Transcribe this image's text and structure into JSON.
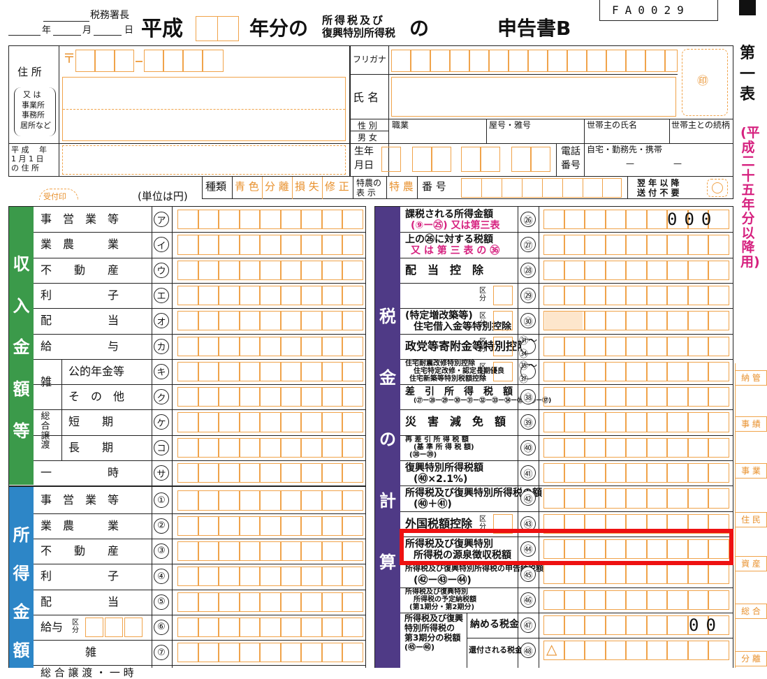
{
  "header": {
    "office_suffix": "税務署長",
    "date_year": "年",
    "date_month": "月",
    "date_day": "日",
    "era": "平成",
    "year_suffix": "年分の",
    "tax_line1": "所得税及び",
    "tax_line2": "復興特別所得税",
    "no": "の",
    "title": "申告書B",
    "form_code": "FA0029"
  },
  "address": {
    "label": "住 所",
    "sub_line1": "又 は",
    "sub_line2": "事業所",
    "sub_line3": "事務所",
    "sub_line4": "居所など",
    "postal_mark": "〒",
    "jan1_line1": "平 成　 年",
    "jan1_line2": "1 月 1 日",
    "jan1_line3": "の 住 所"
  },
  "person": {
    "furigana": "フリガナ",
    "name": "氏 名",
    "seal": "㊞",
    "gender": "性 別",
    "male_female": "男 女",
    "occupation": "職業",
    "trade_name": "屋号・雅号",
    "householder": "世帯主の氏名",
    "relation": "世帯主との続柄",
    "birth_line1": "生年",
    "birth_line2": "月日",
    "phone_line1": "電話",
    "phone_line2": "番号",
    "phone_type": "自宅・勤務先・携帯",
    "phone_dash": "—"
  },
  "type_row": {
    "reception": "受付印",
    "unit": "(単位は円)",
    "kind": "種類",
    "options": [
      "青 色",
      "分 離",
      "損 失",
      "修 正"
    ],
    "tokuno_label_1": "特農の",
    "tokuno_label_2": "表 示",
    "tokuno": "特 農",
    "number": "番 号",
    "next_year_1": "翌 年 以 降",
    "next_year_2": "送 付 不 要"
  },
  "side_title": "第一表",
  "side_sub": "(平成二十五年分以降用)",
  "income_section": {
    "title": [
      "収",
      "入",
      "金",
      "額",
      "等"
    ],
    "rows": [
      {
        "label": "事　営　業　等",
        "mark": "ア"
      },
      {
        "label": "業　農　　　業",
        "mark": "イ"
      },
      {
        "label": "不　　動　　産",
        "mark": "ウ"
      },
      {
        "label": "利　　　　　子",
        "mark": "エ"
      },
      {
        "label": "配　　　　　当",
        "mark": "オ"
      },
      {
        "label": "給　　　　　与",
        "mark": "カ"
      },
      {
        "label": "公的年金等",
        "mark": "キ"
      },
      {
        "label": "そ　の　他",
        "mark": "ク"
      },
      {
        "label": "短　　期",
        "mark": "ケ"
      },
      {
        "label": "長　　期",
        "mark": "コ"
      },
      {
        "label": "一　　　　　時",
        "mark": "サ"
      }
    ],
    "misc": "雑",
    "transfer": [
      "総",
      "合",
      "譲",
      "渡"
    ]
  },
  "shotoku_section": {
    "title": [
      "所",
      "得",
      "金",
      "額"
    ],
    "rows": [
      {
        "label": "事　営　業　等",
        "mark": "①"
      },
      {
        "label": "業　農　　　業",
        "mark": "②"
      },
      {
        "label": "不　　動　　産",
        "mark": "③"
      },
      {
        "label": "利　　　　　子",
        "mark": "④"
      },
      {
        "label": "配　　　　　当",
        "mark": "⑤"
      },
      {
        "label": "給与",
        "mark": "⑥"
      },
      {
        "label": "雑",
        "mark": "⑦"
      }
    ],
    "kubun": "区分",
    "bottom_partial": "総 合 譲 渡 ・ 一 時"
  },
  "tax_section": {
    "title": [
      "税",
      "金",
      "の",
      "計",
      "算"
    ],
    "rows": [
      {
        "label_1": "課税される所得金額",
        "label_2": "(⑨ー㉕) 又は第三表",
        "mark": "㉖",
        "value": "000"
      },
      {
        "label_1": "上の㉖に対する税額",
        "label_2": "又 は 第 三 表 の ㊱",
        "mark": "㉗"
      },
      {
        "label_1": "配　当　控　除",
        "mark": "㉘"
      },
      {
        "label_1": "",
        "mark": "㉙"
      },
      {
        "label_1": "(特定増改築等)",
        "label_2": "住宅借入金等特別控除",
        "mark": "㉚"
      },
      {
        "label_1": "政党等寄附金等特別控除",
        "mark": "㉛〜㉞"
      },
      {
        "label_1": "住宅耐震改修特別控除",
        "label_2": "住宅特定改修・認定長期優良",
        "label_3": "住宅新築等特別税額控除",
        "mark": "㉟〜㊲"
      },
      {
        "label_1": "差　引　所　得　税　額",
        "label_2": "(㉗ー㉘ー㉙ー㉚ー㉛ー㉜ー㉝ー㉞ー㉟ー㊱ー㊲)",
        "mark": "㊳"
      },
      {
        "label_1": "災　害　減　免　額",
        "mark": "㊴"
      },
      {
        "label_1": "再 差 引 所 得 税 額",
        "label_2": "(基 準 所 得 税 額)",
        "label_3": "(㊳ー㊴)",
        "mark": "㊵"
      },
      {
        "label_1": "復興特別所得税額",
        "label_2": "(㊵×2.1%)",
        "mark": "㊶"
      },
      {
        "label_1": "所得税及び復興特別所得税の額",
        "label_2": "(㊵＋㊶)",
        "mark": "㊷"
      },
      {
        "label_1": "外国税額控除",
        "mark": "㊸"
      },
      {
        "label_1": "所得税及び復興特別",
        "label_2": "所得税の源泉徴収税額",
        "mark": "㊹"
      },
      {
        "label_1": "所得税及び復興特別所得税の申告納税額",
        "label_2": "(㊷ー㊸ー㊹)",
        "mark": "㊺"
      },
      {
        "label_1": "所得税及び復興特別",
        "label_2": "所得税の予定納税額",
        "label_3": "(第1期分・第2期分)",
        "mark": "㊻"
      }
    ],
    "kubun": "区分",
    "third_period_1": "所得税及び復興",
    "third_period_2": "特別所得税の",
    "third_period_3": "第3期分の税額",
    "third_period_4": "(㊺ー㊻)",
    "pay": "納める税金",
    "refund": "還付される税金",
    "mark_pay": "㊼",
    "mark_refund": "㊽",
    "pay_value": "00",
    "refund_sign": "△"
  },
  "right_labels": [
    "納 管",
    "事 績",
    "事 業",
    "住 民",
    "資 産",
    "総 合",
    "分 離"
  ]
}
